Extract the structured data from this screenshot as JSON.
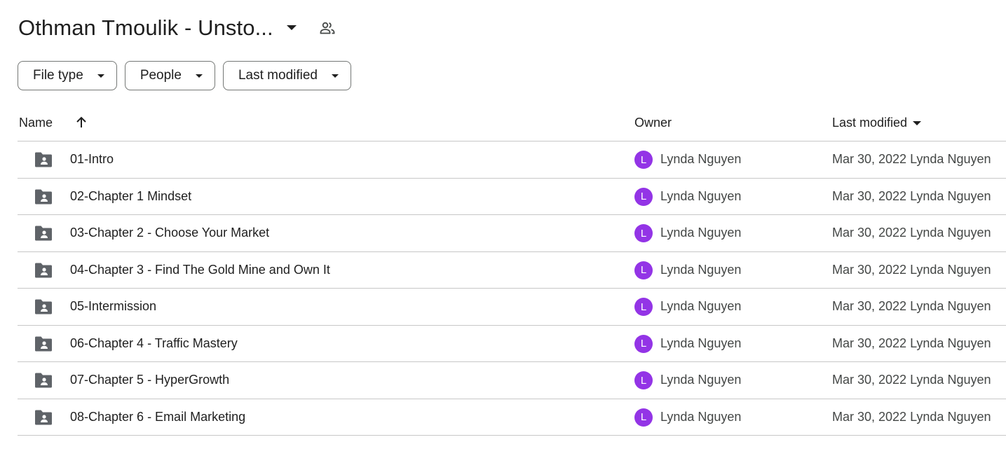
{
  "header": {
    "title": "Othman Tmoulik - Unsto...",
    "caret_icon": "arrow-drop-down-icon",
    "share_icon": "people-icon"
  },
  "filters": [
    {
      "label": "File type"
    },
    {
      "label": "People"
    },
    {
      "label": "Last modified"
    }
  ],
  "columns": {
    "name": "Name",
    "owner": "Owner",
    "last_modified": "Last modified"
  },
  "colors": {
    "avatar": "#9334e6",
    "folder": "#5f6368",
    "divider": "#c7c7c7"
  },
  "rows": [
    {
      "name": "01-Intro",
      "owner_initial": "L",
      "owner": "Lynda Nguyen",
      "modified": "Mar 30, 2022 Lynda Nguyen"
    },
    {
      "name": "02-Chapter 1 Mindset",
      "owner_initial": "L",
      "owner": "Lynda Nguyen",
      "modified": "Mar 30, 2022 Lynda Nguyen"
    },
    {
      "name": "03-Chapter 2 - Choose Your Market",
      "owner_initial": "L",
      "owner": "Lynda Nguyen",
      "modified": "Mar 30, 2022 Lynda Nguyen"
    },
    {
      "name": "04-Chapter 3 - Find The Gold Mine and Own It",
      "owner_initial": "L",
      "owner": "Lynda Nguyen",
      "modified": "Mar 30, 2022 Lynda Nguyen"
    },
    {
      "name": "05-Intermission",
      "owner_initial": "L",
      "owner": "Lynda Nguyen",
      "modified": "Mar 30, 2022 Lynda Nguyen"
    },
    {
      "name": "06-Chapter 4 - Traffic Mastery",
      "owner_initial": "L",
      "owner": "Lynda Nguyen",
      "modified": "Mar 30, 2022 Lynda Nguyen"
    },
    {
      "name": "07-Chapter 5 - HyperGrowth",
      "owner_initial": "L",
      "owner": "Lynda Nguyen",
      "modified": "Mar 30, 2022 Lynda Nguyen"
    },
    {
      "name": "08-Chapter 6 - Email Marketing",
      "owner_initial": "L",
      "owner": "Lynda Nguyen",
      "modified": "Mar 30, 2022 Lynda Nguyen"
    }
  ]
}
